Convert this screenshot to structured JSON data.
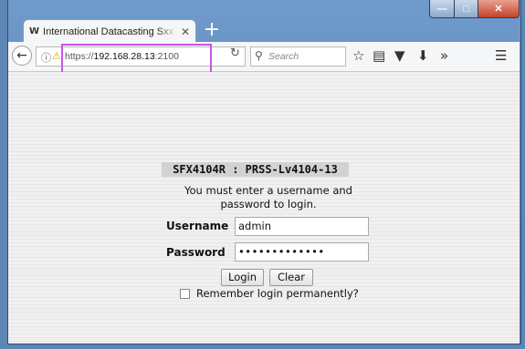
{
  "browser": {
    "tab": {
      "title": "International Datacasting Sxx",
      "favicon": "w-logo-icon"
    },
    "new_tab_label": "+",
    "url": {
      "scheme": "https://",
      "host": "192.168.28.13",
      "port": ":2100"
    },
    "search_placeholder": "Search",
    "icons": [
      "back-arrow-icon",
      "info-icon",
      "lock-warning-icon",
      "reload-icon",
      "search-icon",
      "bookmark-star-icon",
      "reader-view-icon",
      "pocket-icon",
      "download-icon",
      "overflow-chevron-icon",
      "hamburger-menu-icon"
    ],
    "highlight_color": "#c855e8"
  },
  "login": {
    "title": "SFX4104R : PRSS-Lv4104-13",
    "message": "You must enter a username and password to login.",
    "username_label": "Username",
    "username_value": "admin",
    "password_label": "Password",
    "password_value": "•••••••••••••",
    "login_button": "Login",
    "clear_button": "Clear",
    "remember_label": "Remember login permanently?"
  }
}
